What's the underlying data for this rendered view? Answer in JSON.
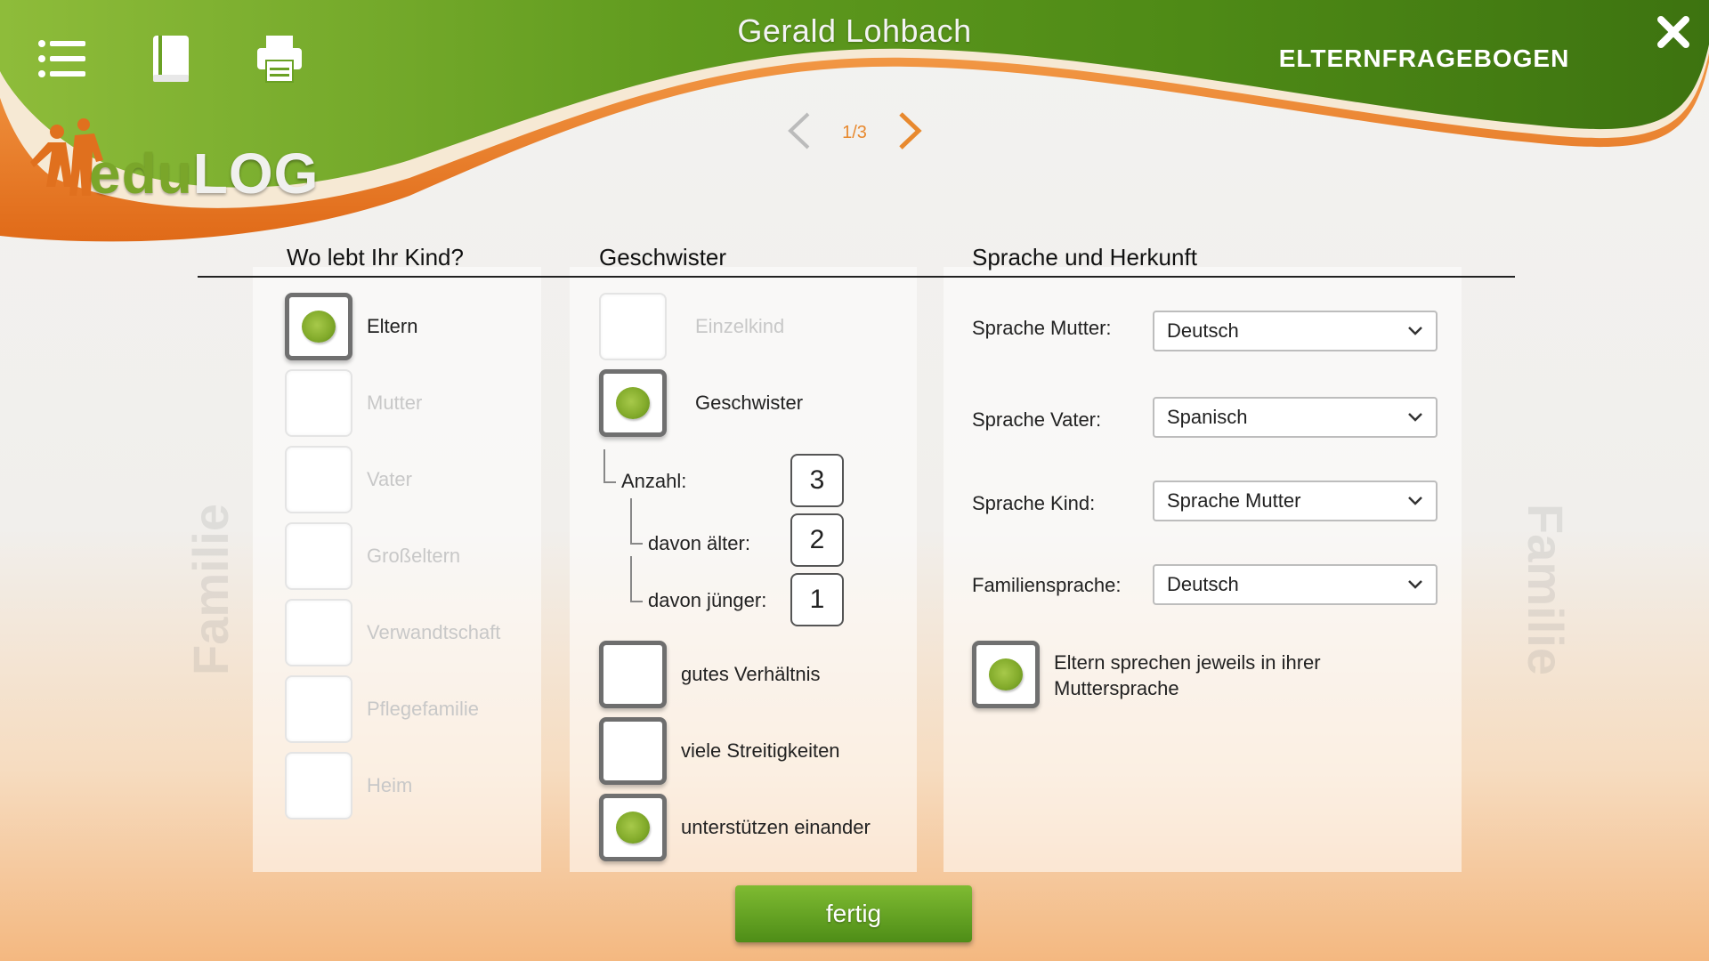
{
  "header": {
    "user_name": "Gerald Lohbach",
    "app_title": "ELTERNFRAGEBOGEN",
    "pager": "1/3",
    "logo": {
      "edu": "edu",
      "log": "LOG"
    }
  },
  "side_labels": {
    "left": "Familie",
    "right": "Familie"
  },
  "living": {
    "title": "Wo lebt Ihr Kind?",
    "options": [
      {
        "label": "Eltern",
        "checked": true,
        "enabled": true
      },
      {
        "label": "Mutter",
        "checked": false,
        "enabled": false
      },
      {
        "label": "Vater",
        "checked": false,
        "enabled": false
      },
      {
        "label": "Großeltern",
        "checked": false,
        "enabled": false
      },
      {
        "label": "Verwandtschaft",
        "checked": false,
        "enabled": false
      },
      {
        "label": "Pflegefamilie",
        "checked": false,
        "enabled": false
      },
      {
        "label": "Heim",
        "checked": false,
        "enabled": false
      }
    ]
  },
  "siblings": {
    "title": "Geschwister",
    "einzelkind": "Einzelkind",
    "geschwister": "Geschwister",
    "count_label": "Anzahl:",
    "count": "3",
    "older_label": "davon älter:",
    "older": "2",
    "younger_label": "davon jünger:",
    "younger": "1",
    "relations": [
      {
        "label": "gutes Verhältnis",
        "checked": false
      },
      {
        "label": "viele Streitigkeiten",
        "checked": false
      },
      {
        "label": "unterstützen einander",
        "checked": true
      }
    ]
  },
  "language": {
    "title": "Sprache und Herkunft",
    "fields": [
      {
        "label": "Sprache Mutter:",
        "value": "Deutsch"
      },
      {
        "label": "Sprache Vater:",
        "value": "Spanisch"
      },
      {
        "label": "Sprache Kind:",
        "value": "Sprache Mutter"
      },
      {
        "label": "Familiensprache:",
        "value": "Deutsch"
      }
    ],
    "native_note_line1": "Eltern sprechen jeweils in ihrer",
    "native_note_line2": "Muttersprache"
  },
  "done_label": "fertig",
  "colors": {
    "green": "#6ea52a",
    "orange": "#e8892e"
  }
}
